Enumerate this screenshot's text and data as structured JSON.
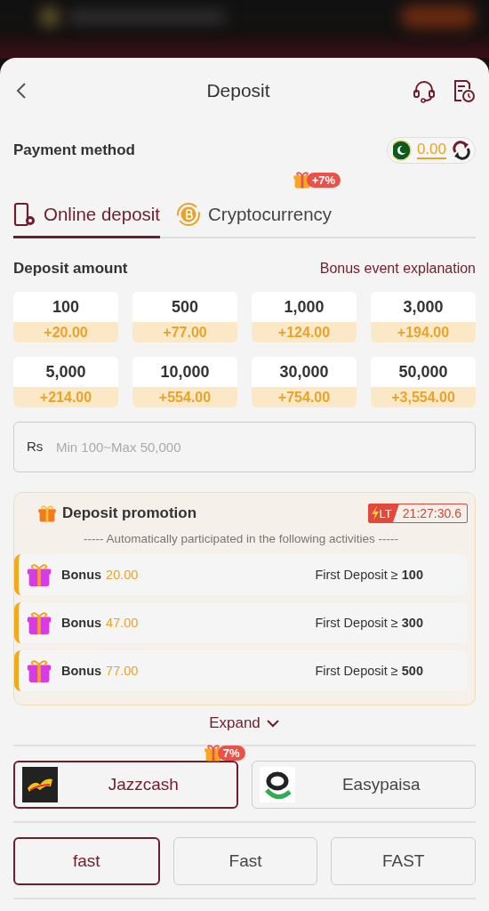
{
  "header": {
    "title": "Deposit"
  },
  "payment_method": {
    "label": "Payment method",
    "balance": "0.00"
  },
  "tabs": [
    {
      "label": "Online deposit",
      "selected": true,
      "kind": "phone"
    },
    {
      "label": "Cryptocurrency",
      "selected": false,
      "kind": "coin",
      "badge": "+7%"
    }
  ],
  "deposit_amount": {
    "label": "Deposit amount",
    "link": "Bonus event explanation"
  },
  "amounts": [
    {
      "amount": "100",
      "bonus": "+20.00"
    },
    {
      "amount": "500",
      "bonus": "+77.00"
    },
    {
      "amount": "1,000",
      "bonus": "+124.00"
    },
    {
      "amount": "3,000",
      "bonus": "+194.00"
    },
    {
      "amount": "5,000",
      "bonus": "+214.00"
    },
    {
      "amount": "10,000",
      "bonus": "+554.00"
    },
    {
      "amount": "30,000",
      "bonus": "+754.00"
    },
    {
      "amount": "50,000",
      "bonus": "+3,554.00"
    }
  ],
  "amount_field": {
    "currency": "Rs",
    "placeholder": "Min 100~Max 50,000"
  },
  "promotion": {
    "title": "Deposit promotion",
    "timer_tag": "LT",
    "timer": "21:27:30.6",
    "subtitle": "----- Automatically participated in the following activities -----",
    "items": [
      {
        "label": "Bonus",
        "amount": "20.00",
        "condition": "First Deposit ≥ **100**"
      },
      {
        "label": "Bonus",
        "amount": "47.00",
        "condition": "First Deposit ≥ **300**"
      },
      {
        "label": "Bonus",
        "amount": "77.00",
        "condition": "First Deposit ≥ **500**"
      }
    ]
  },
  "expand": "Expand",
  "channels": [
    {
      "name": "Jazzcash",
      "selected": true,
      "kind": "jazzcash",
      "badge": "7%"
    },
    {
      "name": "Easypaisa",
      "selected": false,
      "kind": "easypaisa"
    }
  ],
  "speeds": [
    {
      "label": "fast",
      "selected": true
    },
    {
      "label": "Fast",
      "selected": false
    },
    {
      "label": "FAST",
      "selected": false
    }
  ]
}
